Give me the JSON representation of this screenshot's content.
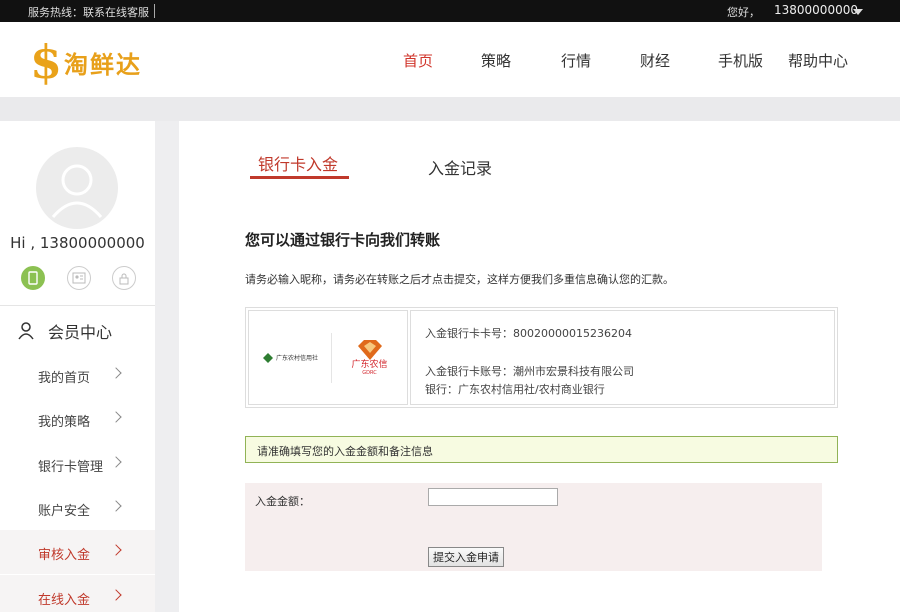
{
  "topbar": {
    "hotline": "服务热线：联系在线客服",
    "greeting": "您好，",
    "username": "13800000000"
  },
  "header": {
    "logo_symbol": "$",
    "logo_text": "淘鲜达",
    "nav": [
      "首页",
      "策略",
      "行情",
      "财经",
      "手机版",
      "帮助中心"
    ],
    "active_nav": "首页"
  },
  "sidebar": {
    "hi_text": "Hi , 13800000000",
    "section_title": "会员中心",
    "items": [
      {
        "label": "我的首页"
      },
      {
        "label": "我的策略"
      },
      {
        "label": "银行卡管理"
      },
      {
        "label": "账户安全"
      },
      {
        "label": "审核入金"
      },
      {
        "label": "在线入金"
      }
    ]
  },
  "main": {
    "tabs": [
      "银行卡入金",
      "入金记录"
    ],
    "heading": "您可以通过银行卡向我们转账",
    "notice": "请务必输入昵称，请务必在转账之后才点击提交，这样方便我们多重信息确认您的汇款。",
    "bank": {
      "logo1_text": "广东农村信用社",
      "logo2_text": "广东农信",
      "logo2_sub": "GDRC",
      "card_no": "入金银行卡卡号：80020000015236204",
      "account": "入金银行卡账号：潮州市宏景科技有限公司",
      "bank_name": "银行：广东农村信用社/农村商业银行"
    },
    "hint": "请准确填写您的入金金额和备注信息",
    "form": {
      "amount_label": "入金金额：",
      "amount_value": "",
      "submit_label": "提交入金申请"
    }
  },
  "colors": {
    "accent_red": "#c0392b",
    "logo_gold": "#e9a21a",
    "status_green": "#8cc152"
  }
}
